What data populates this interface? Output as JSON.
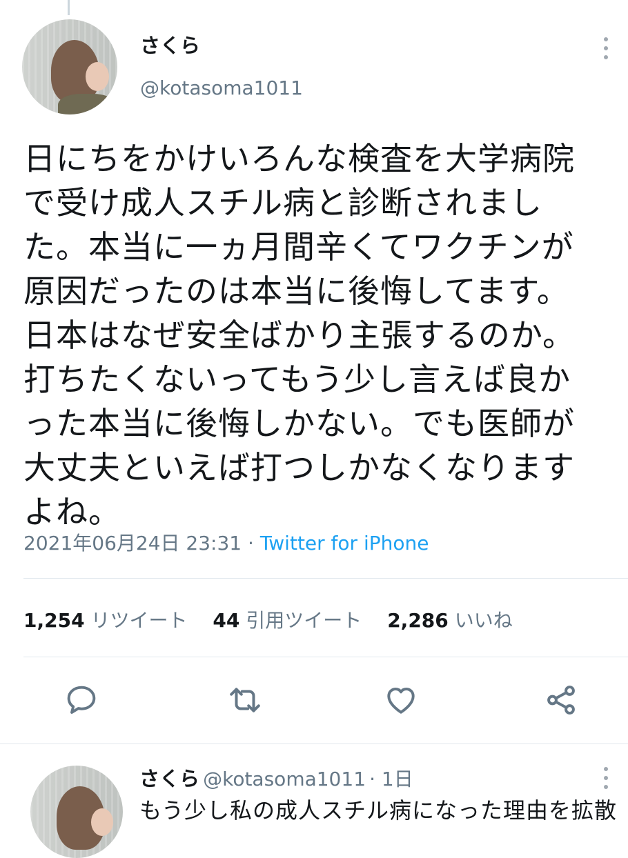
{
  "tweet": {
    "author_name": "さくら",
    "author_handle": "@kotasoma1011",
    "text_lines": [
      "日にちをかけいろんな検査を大学病院",
      "で受け成人スチル病と診断されまし",
      "た。本当に一ヵ月間辛くてワクチンが",
      "原因だったのは本当に後悔してます。",
      "日本はなぜ安全ばかり主張するのか。",
      "打ちたくないってもう少し言えば良か",
      "った本当に後悔しかない。でも医師が",
      "大丈夫といえば打つしかなくなります",
      "よね。"
    ],
    "timestamp": "2021年06月24日 23:31",
    "separator": " · ",
    "source": "Twitter for iPhone"
  },
  "stats": {
    "retweets_count": "1,254",
    "retweets_label": "リツイート",
    "quotes_count": "44",
    "quotes_label": "引用ツイート",
    "likes_count": "2,286",
    "likes_label": "いいね"
  },
  "actions": {
    "icons": [
      "reply-icon",
      "retweet-icon",
      "like-icon",
      "share-icon"
    ]
  },
  "reply": {
    "author_name": "さくら",
    "author_handle": "@kotasoma1011",
    "time": "· 1日",
    "text": "もう少し私の成人スチル病になった理由を拡散"
  },
  "colors": {
    "accent": "#1da1f2",
    "secondary_text": "#657786",
    "icon_gray": "#657786",
    "divider": "#e1e8ed"
  }
}
